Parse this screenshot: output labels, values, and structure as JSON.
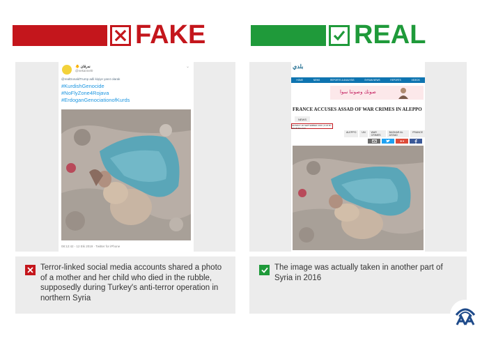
{
  "header": {
    "fake_label": "FAKE",
    "real_label": "REAL",
    "fake_color": "#c4161c",
    "real_color": "#1f9a3a"
  },
  "fake": {
    "tweet": {
      "name": "🐥 نه‌رقان",
      "handle": "@nekannel0",
      "reply_text": "@realDonaldTrump adli kişiye yanıt olarak",
      "hashtags": [
        "#KurdishGenocide",
        "#NoFlyZone4Rojava",
        "#ErdoganGenociationofKurds"
      ],
      "timestamp": "08:12:42 - 12 Eki 2019 · Twitter for iPhone"
    },
    "caption": "Terror-linked social media accounts shared a photo of a mother and her child who died in the rubble, supposedly during Turkey's anti-terror operation in northern Syria"
  },
  "real": {
    "article": {
      "logo": "بلدي",
      "nav": [
        "HOME",
        "NEWS",
        "REPORTS & ANALYSIS",
        "SYRIAN NEWS",
        "REPORTS",
        "VIDEOS"
      ],
      "banner": "صوتك وصوتنا سوا",
      "title": "FRANCE ACCUSES ASSAD OF WAR CRIMES IN ALEPPO",
      "news_tag": "NEWS",
      "date": "MONDAY 26 SEPTEMBER 2016 | 9:23 BY ENAB BALADI",
      "tags": [
        "ALEPPO",
        "UN",
        "WAR CRIMES",
        "BASHAR AL ASSAD",
        "FRANCE"
      ]
    },
    "caption": "The image was actually taken in another part of Syria in 2016"
  }
}
